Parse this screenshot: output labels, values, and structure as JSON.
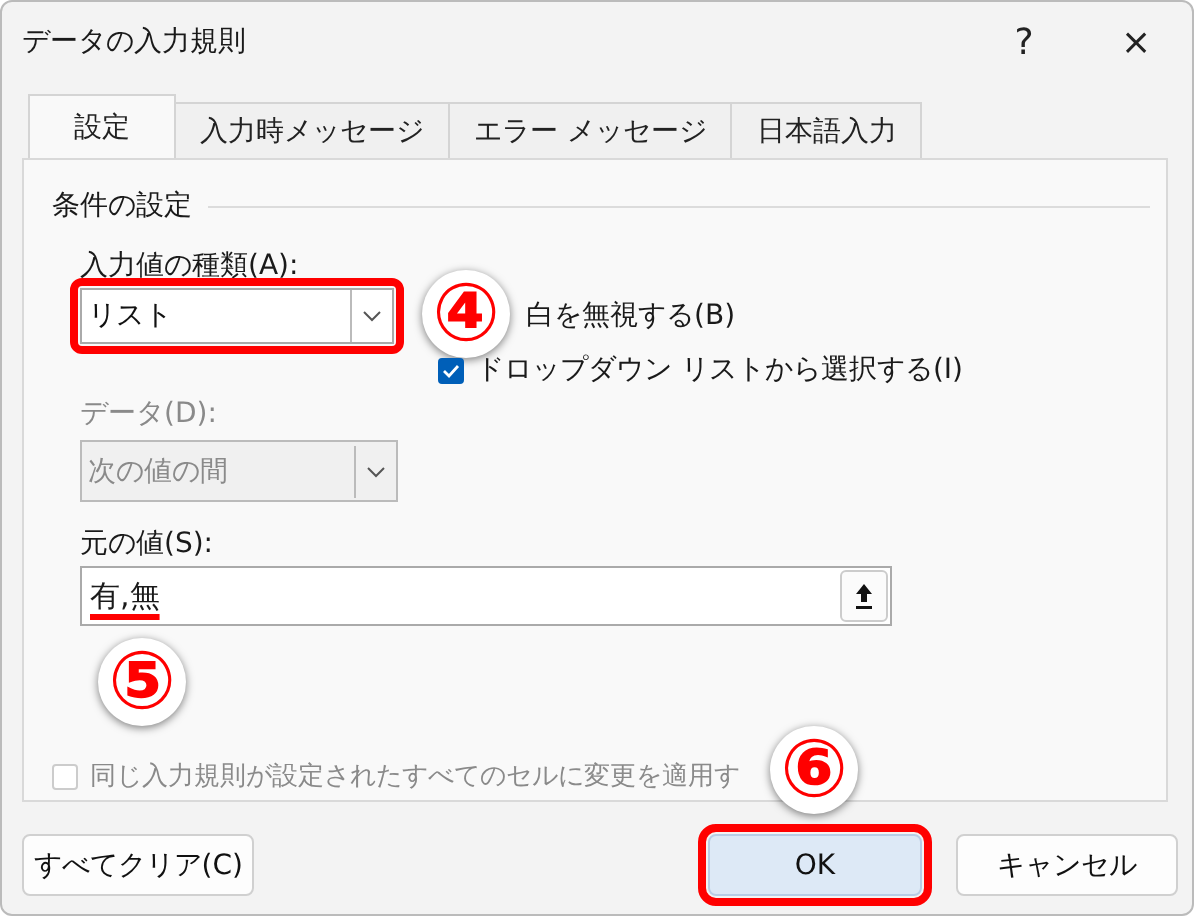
{
  "window": {
    "title": "データの入力規則",
    "help_button": "?",
    "close_button": "×"
  },
  "tabs": [
    {
      "label": "設定",
      "selected": true
    },
    {
      "label": "入力時メッセージ",
      "selected": false
    },
    {
      "label": "エラー メッセージ",
      "selected": false
    },
    {
      "label": "日本語入力",
      "selected": false
    }
  ],
  "section_title": "条件の設定",
  "allow": {
    "label": "入力値の種類(A):",
    "value": "リスト",
    "highlighted": true
  },
  "checkboxes": [
    {
      "label": "白を無視する(B)",
      "kind": "covered"
    },
    {
      "label": "ドロップダウン リストから選択する(I)",
      "kind": "checkbox",
      "checked": true
    }
  ],
  "data": {
    "label": "データ(D):",
    "value": "次の値の間",
    "disabled": true
  },
  "source": {
    "label": "元の値(S):",
    "value": "有,無",
    "underlined": true
  },
  "apply_all": {
    "label": "同じ入力規則が設定されたすべてのセルに変更を適用す",
    "checked": false,
    "disabled": true
  },
  "buttons": [
    {
      "label": "すべてクリア(C)",
      "default": false,
      "highlighted": false
    },
    {
      "label": "OK",
      "default": true,
      "highlighted": true
    },
    {
      "label": "キャンセル",
      "default": false,
      "highlighted": false
    }
  ],
  "annotations": [
    {
      "label": "④"
    },
    {
      "label": "⑤"
    },
    {
      "label": "⑥"
    }
  ]
}
